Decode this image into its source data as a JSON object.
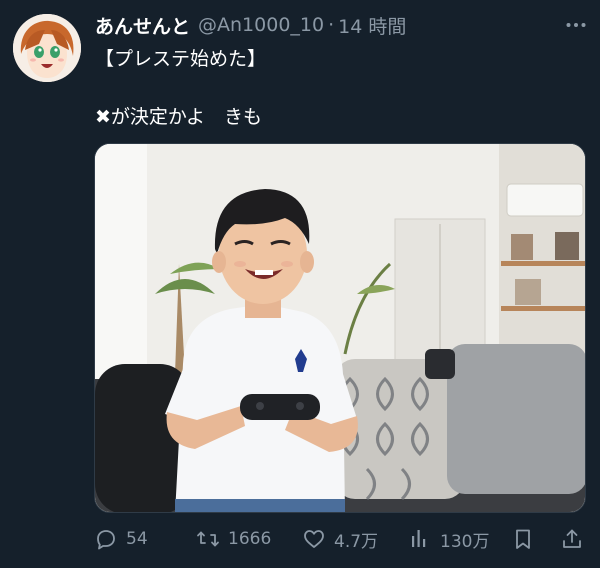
{
  "post": {
    "display_name": "あんせんと",
    "handle": "@An1000_10",
    "separator": "·",
    "time": "14 時間",
    "text_line1": "【プレステ始めた】",
    "text_line2": "✖が決定かよ　きも"
  },
  "media": {
    "alt": "photo of a smiling child in a white t-shirt holding a game controller on a sofa"
  },
  "actions": {
    "reply_count": "54",
    "retweet_count": "1666",
    "like_count": "4.7万",
    "view_count": "130万"
  },
  "icons": {
    "reply": "speech-bubble-icon",
    "retweet": "retweet-icon",
    "like": "heart-icon",
    "views": "bar-chart-icon",
    "bookmark": "bookmark-icon",
    "share": "share-icon",
    "more": "more-icon"
  },
  "colors": {
    "background": "#15202b",
    "secondary_text": "#8b98a5",
    "primary_text": "#ffffff"
  }
}
